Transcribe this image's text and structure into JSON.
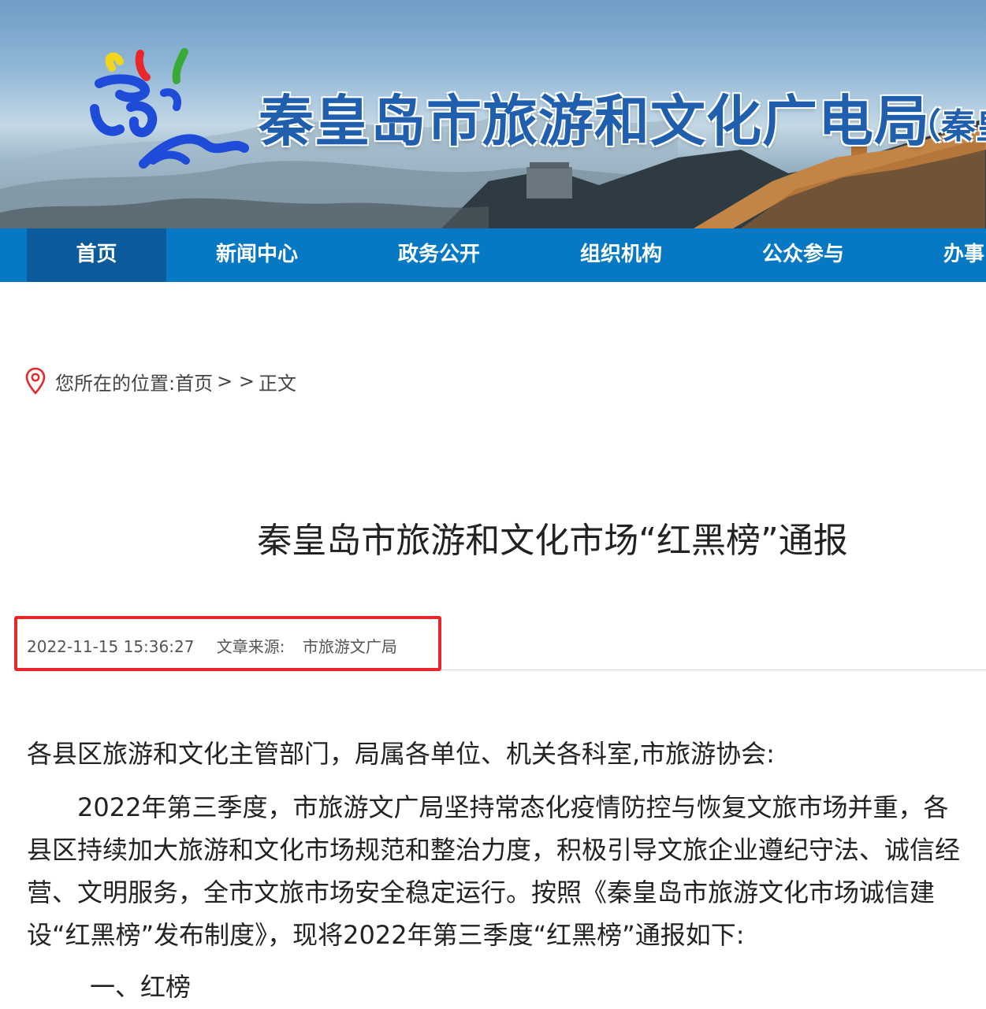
{
  "header": {
    "title": "秦皇岛市旅游和文化广电局",
    "title_suffix": "（秦皇",
    "nav": [
      {
        "label": "首页",
        "active": true
      },
      {
        "label": "新闻中心",
        "active": false
      },
      {
        "label": "政务公开",
        "active": false
      },
      {
        "label": "组织机构",
        "active": false
      },
      {
        "label": "公众参与",
        "active": false
      },
      {
        "label": "办事",
        "active": false
      }
    ]
  },
  "breadcrumb": {
    "prefix": "您所在的位置:",
    "home": "首页",
    "sep": "> >",
    "current": "正文",
    "icon": "location-pin-icon"
  },
  "article": {
    "title": "秦皇岛市旅游和文化市场“红黑榜”通报",
    "datetime": "2022-11-15 15:36:27",
    "source_label": "文章来源:",
    "source": "市旅游文广局",
    "highlight_color": "#e8272b",
    "paragraphs": [
      "各县区旅游和文化主管部门，局属各单位、机关各科室,市旅游协会:",
      "2022年第三季度，市旅游文广局坚持常态化疫情防控与恢复文旅市场并重，各县区持续加大旅游和文化市场规范和整治力度，积极引导文旅企业遵纪守法、诚信经营、文明服务，全市文旅市场安全稳定运行。按照《秦皇岛市旅游文化市场诚信建设“红黑榜”发布制度》，现将2022年第三季度“红黑榜”通报如下:",
      "一、红榜"
    ]
  },
  "colors": {
    "nav_bg": "#0779c4",
    "nav_active_bg": "#0a5a9c",
    "title_blue": "#1f5fae"
  }
}
